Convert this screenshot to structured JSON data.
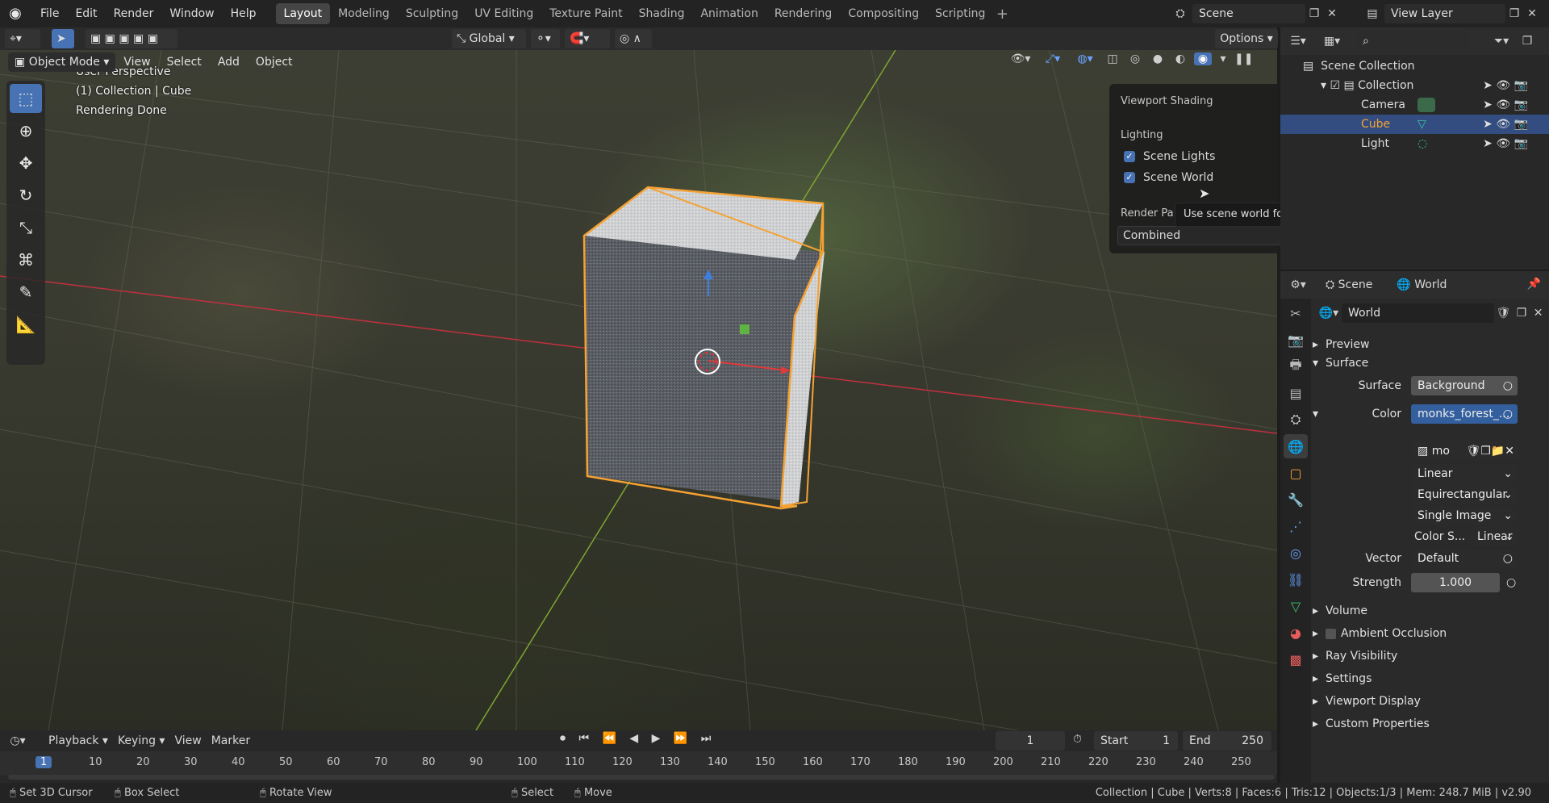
{
  "menu": {
    "items": [
      "File",
      "Edit",
      "Render",
      "Window",
      "Help"
    ]
  },
  "workspaces": [
    "Layout",
    "Modeling",
    "Sculpting",
    "UV Editing",
    "Texture Paint",
    "Shading",
    "Animation",
    "Rendering",
    "Compositing",
    "Scripting"
  ],
  "scene": {
    "label": "Scene"
  },
  "view_layer": {
    "label": "View Layer"
  },
  "tool_header": {
    "transform": "Global",
    "options": "Options"
  },
  "viewport_header": {
    "mode": "Object Mode",
    "view": "View",
    "select": "Select",
    "add": "Add",
    "object": "Object"
  },
  "overlay": {
    "line1": "User Perspective",
    "line2": "(1) Collection | Cube",
    "line3": "Rendering Done"
  },
  "shading_popover": {
    "title": "Viewport Shading",
    "lighting": "Lighting",
    "scene_lights": "Scene Lights",
    "scene_world": "Scene World",
    "render_pass_label": "Render Pa",
    "render_pass_value": "Combined"
  },
  "tooltip": "Use scene world for lighting.",
  "outliner": {
    "root": "Scene Collection",
    "items": [
      "Collection",
      "Camera",
      "Cube",
      "Light"
    ]
  },
  "properties": {
    "scene_tab": "Scene",
    "world_tab": "World",
    "datablock": "World",
    "preview": "Preview",
    "surface_panel": "Surface",
    "surface_label": "Surface",
    "surface_value": "Background",
    "color_label": "Color",
    "color_value": "monks_forest_...",
    "image_name": "mo",
    "interp": "Linear",
    "projection": "Equirectangular",
    "source": "Single Image",
    "colorspace_label": "Color S...",
    "colorspace_value": "Linear",
    "vector_label": "Vector",
    "vector_value": "Default",
    "strength_label": "Strength",
    "strength_value": "1.000",
    "panels": [
      "Volume",
      "Ambient Occlusion",
      "Ray Visibility",
      "Settings",
      "Viewport Display",
      "Custom Properties"
    ]
  },
  "timeline": {
    "playback": "Playback",
    "keying": "Keying",
    "view": "View",
    "marker": "Marker",
    "current_frame": "1",
    "start_label": "Start",
    "start": "1",
    "end_label": "End",
    "end": "250",
    "ticks": [
      "1",
      "10",
      "20",
      "30",
      "40",
      "50",
      "60",
      "70",
      "80",
      "90",
      "100",
      "110",
      "120",
      "130",
      "140",
      "150",
      "160",
      "170",
      "180",
      "190",
      "200",
      "210",
      "220",
      "230",
      "240",
      "250"
    ]
  },
  "status": {
    "cursor": "Set 3D Cursor",
    "box": "Box Select",
    "rotate": "Rotate View",
    "select": "Select",
    "move": "Move",
    "info": "Collection | Cube | Verts:8 | Faces:6 | Tris:12 | Objects:1/3 | Mem: 248.7 MiB | v2.90"
  },
  "colors": {
    "accent": "#4772b3",
    "selected_orange": "#f5a234",
    "x_axis": "#c0303f",
    "y_axis": "#7ea630"
  }
}
